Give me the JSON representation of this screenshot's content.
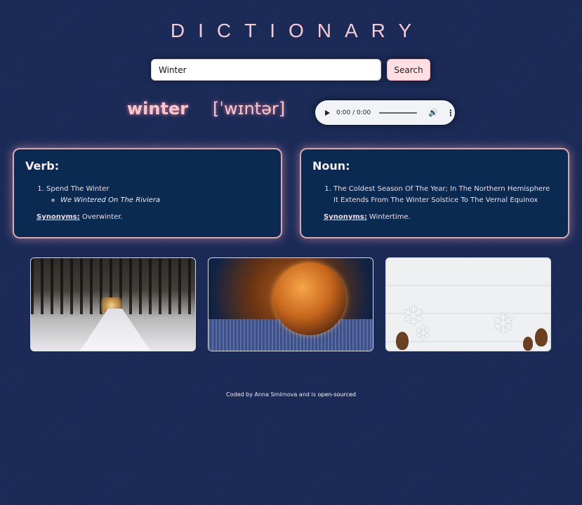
{
  "header": {
    "title": "DICTIONARY"
  },
  "search": {
    "value": "Winter",
    "button_label": "Search"
  },
  "entry": {
    "word": "winter",
    "phonetic": "[ˈwɪntər]",
    "audio": {
      "time": "0:00 / 0:00"
    }
  },
  "meanings": [
    {
      "part_of_speech": "Verb:",
      "definition": "Spend The Winter",
      "example": "We Wintered On The Riviera",
      "synonyms_label": "Synonyms:",
      "synonyms": "Overwinter."
    },
    {
      "part_of_speech": "Noun:",
      "definition": "The Coldest Season Of The Year; In The Northern Hemisphere It Extends From The Winter Solstice To The Vernal Equinox",
      "synonyms_label": "Synonyms:",
      "synonyms": "Wintertime."
    }
  ],
  "images": [
    "snowy-forest-road",
    "frozen-bubble",
    "snowflakes-pinecones"
  ],
  "footer": {
    "prefix": "Coded by Anna Smirnova and is ",
    "link": "open-sourced"
  }
}
